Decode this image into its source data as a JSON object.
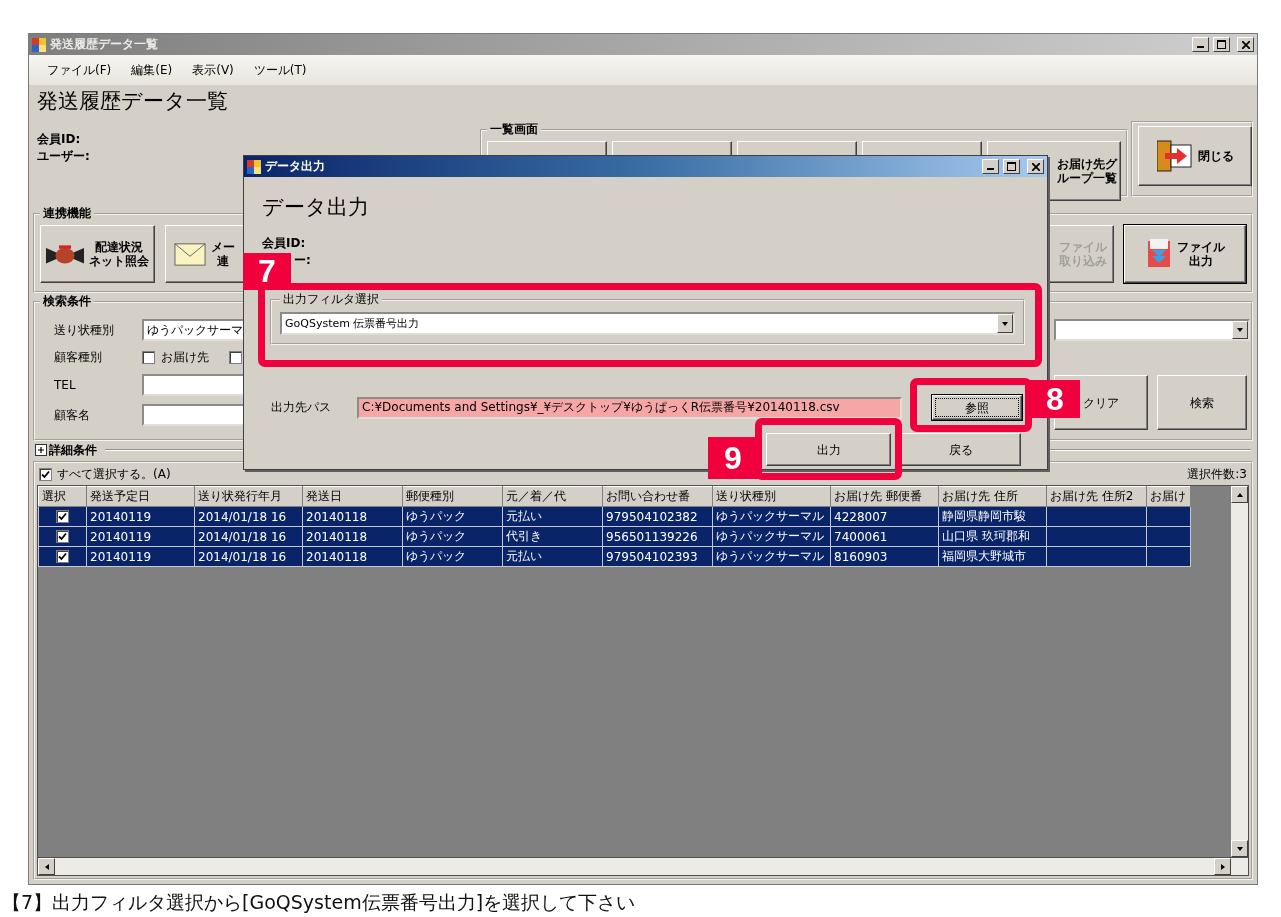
{
  "window": {
    "title": "発送履歴データ一覧"
  },
  "menu": [
    {
      "label": "ファイル(F)"
    },
    {
      "label": "編集(E)"
    },
    {
      "label": "表示(V)"
    },
    {
      "label": "ツール(T)"
    }
  ],
  "heading": "発送履歴データ一覧",
  "info": [
    "会員ID:",
    "ユーザー:"
  ],
  "list_group": {
    "label": "一覧画面",
    "buttons": [
      {
        "kind": "blank"
      },
      {
        "kind": "blank"
      },
      {
        "kind": "blank"
      },
      {
        "kind": "blank"
      },
      {
        "kind": "text",
        "lines": [
          "お届け先グ",
          "ループ一覧"
        ]
      }
    ]
  },
  "close_button": {
    "label": "閉じる"
  },
  "link_group": {
    "label": "連携機能",
    "buttons": [
      {
        "kind": "parcel",
        "lines": [
          "配達状況",
          "ネット照会"
        ],
        "disabled": false
      },
      {
        "kind": "mail",
        "lines": [
          "メー",
          "連"
        ],
        "disabled": false
      },
      {
        "kind": "plain",
        "lines": [
          "ファイル",
          "取り込み"
        ],
        "disabled": true
      },
      {
        "kind": "export",
        "lines": [
          "ファイル",
          "出力"
        ],
        "disabled": false
      }
    ]
  },
  "search": {
    "label": "検索条件",
    "fields": [
      {
        "kind": "combo",
        "label": "送り状種別",
        "value": "ゆうパックサーマ"
      },
      {
        "kind": "checks",
        "label": "顧客種別",
        "options": [
          {
            "label": "お届け先",
            "checked": false
          },
          {
            "checked": false
          }
        ]
      },
      {
        "kind": "text",
        "label": "TEL"
      },
      {
        "kind": "text",
        "label": "顧客名"
      }
    ],
    "buttons": [
      {
        "label": "クリア"
      },
      {
        "label": "検索"
      }
    ]
  },
  "detail": {
    "label": "詳細条件",
    "expanded": false
  },
  "grid": {
    "select_all": {
      "label": "すべて選択する。(A)",
      "checked": true
    },
    "count": "選択件数:3",
    "select_column": "選択",
    "columns": [
      "発送予定日",
      "送り状発行年月",
      "発送日",
      "郵便種別",
      "元／着／代",
      "お問い合わせ番",
      "送り状種別",
      "お届け先 郵便番",
      "お届け先 住所",
      "お届け先 住所2",
      "お届け"
    ],
    "rows": [
      {
        "selected": true,
        "checked": true,
        "cells": [
          "20140119",
          "2014/01/18 16",
          "20140118",
          "ゆうパック",
          "元払い",
          "979504102382",
          "ゆうパックサーマル",
          "4228007",
          "静岡県静岡市駿",
          "",
          ""
        ]
      },
      {
        "selected": true,
        "checked": true,
        "cells": [
          "20140119",
          "2014/01/18 16",
          "20140118",
          "ゆうパック",
          "代引き",
          "956501139226",
          "ゆうパックサーマル",
          "7400061",
          "山口県 玖珂郡和",
          "",
          ""
        ]
      },
      {
        "selected": true,
        "checked": true,
        "cells": [
          "20140119",
          "2014/01/18 16",
          "20140118",
          "ゆうパック",
          "元払い",
          "979504102393",
          "ゆうパックサーマル",
          "8160903",
          "福岡県大野城市",
          "",
          ""
        ]
      }
    ]
  },
  "dialog": {
    "title": "データ出力",
    "heading": "データ出力",
    "info": [
      {
        "text": "会員ID:",
        "partly_hidden": false
      },
      {
        "text": "ー:",
        "partly_hidden": true
      }
    ],
    "filter": {
      "label": "出力フィルタ選択",
      "value": "GoQSystem  伝票番号出力"
    },
    "path": {
      "label": "出力先パス",
      "value": "C:¥Documents and Settings¥_¥デスクトップ¥ゆうぱっくR伝票番号¥20140118.csv"
    },
    "browse_button": {
      "label": "参照",
      "focused": true
    },
    "buttons": [
      {
        "label": "出力",
        "focused": false
      },
      {
        "label": "戻る",
        "focused": false
      }
    ]
  },
  "annotations": [
    {
      "number": "7"
    },
    {
      "number": "8"
    },
    {
      "number": "9"
    }
  ],
  "caption": "【7】出力フィルタ選択から[GoQSystem伝票番号出力]を選択して下さい"
}
